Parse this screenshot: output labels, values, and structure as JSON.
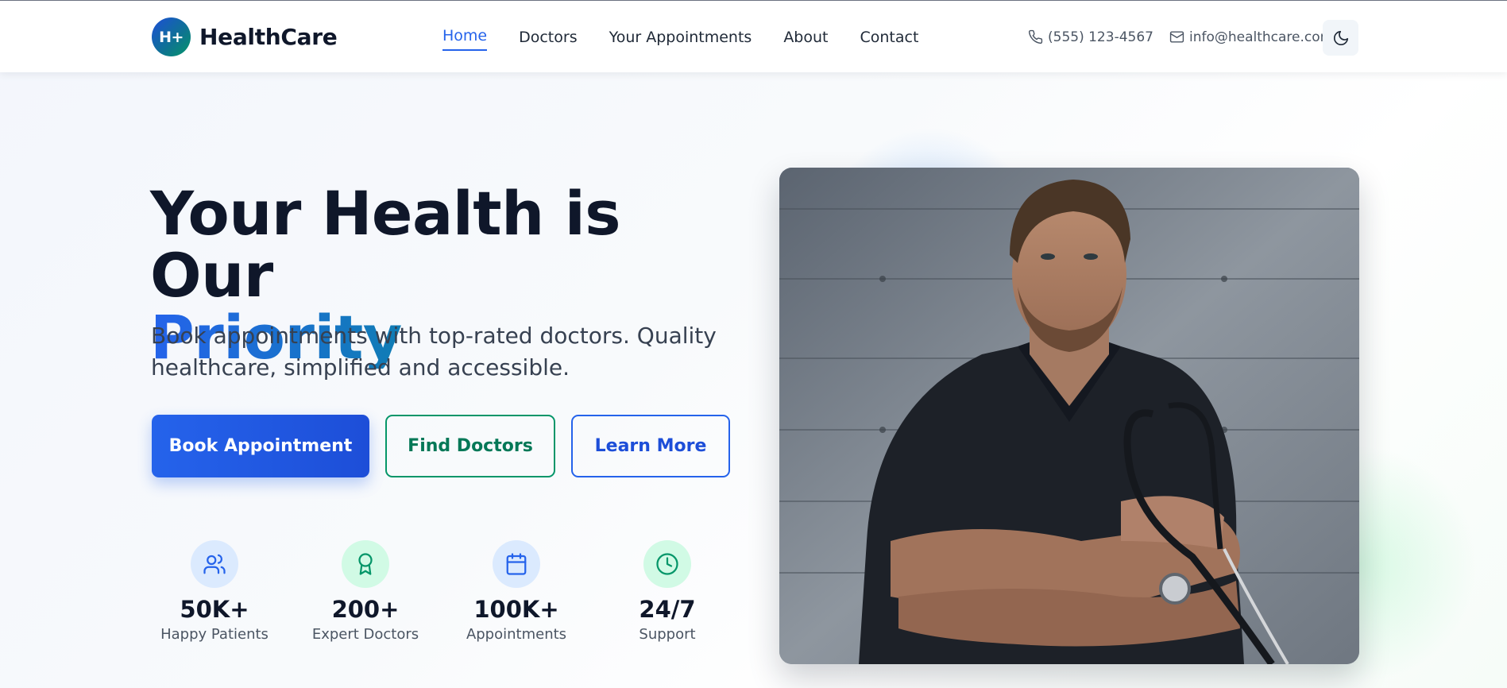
{
  "brand": {
    "logo_text": "H+",
    "name": "HealthCare"
  },
  "nav": {
    "items": [
      {
        "label": "Home",
        "active": true
      },
      {
        "label": "Doctors",
        "active": false
      },
      {
        "label": "Your Appointments",
        "active": false
      },
      {
        "label": "About",
        "active": false
      },
      {
        "label": "Contact",
        "active": false
      }
    ]
  },
  "contact": {
    "phone": "(555) 123-4567",
    "email": "info@healthcare.com",
    "phone_icon": "phone-icon",
    "email_icon": "mail-icon"
  },
  "theme_toggle": {
    "icon": "moon-icon"
  },
  "hero": {
    "title_line1": "Your Health is Our",
    "title_accent": "Priority",
    "subtitle": "Book appointments with top-rated doctors. Quality healthcare, simplified and accessible.",
    "buttons": {
      "primary": "Book Appointment",
      "secondary": "Find Doctors",
      "tertiary": "Learn More"
    },
    "image_icon": "doctor-photo"
  },
  "stats": [
    {
      "icon": "users-icon",
      "value": "50K+",
      "label": "Happy Patients"
    },
    {
      "icon": "award-icon",
      "value": "200+",
      "label": "Expert Doctors"
    },
    {
      "icon": "calendar-icon",
      "value": "100K+",
      "label": "Appointments"
    },
    {
      "icon": "clock-icon",
      "value": "24/7",
      "label": "Support"
    }
  ],
  "colors": {
    "primary": "#2563eb",
    "secondary": "#059669",
    "text_dark": "#0f172a",
    "text_muted": "#4b5563"
  }
}
